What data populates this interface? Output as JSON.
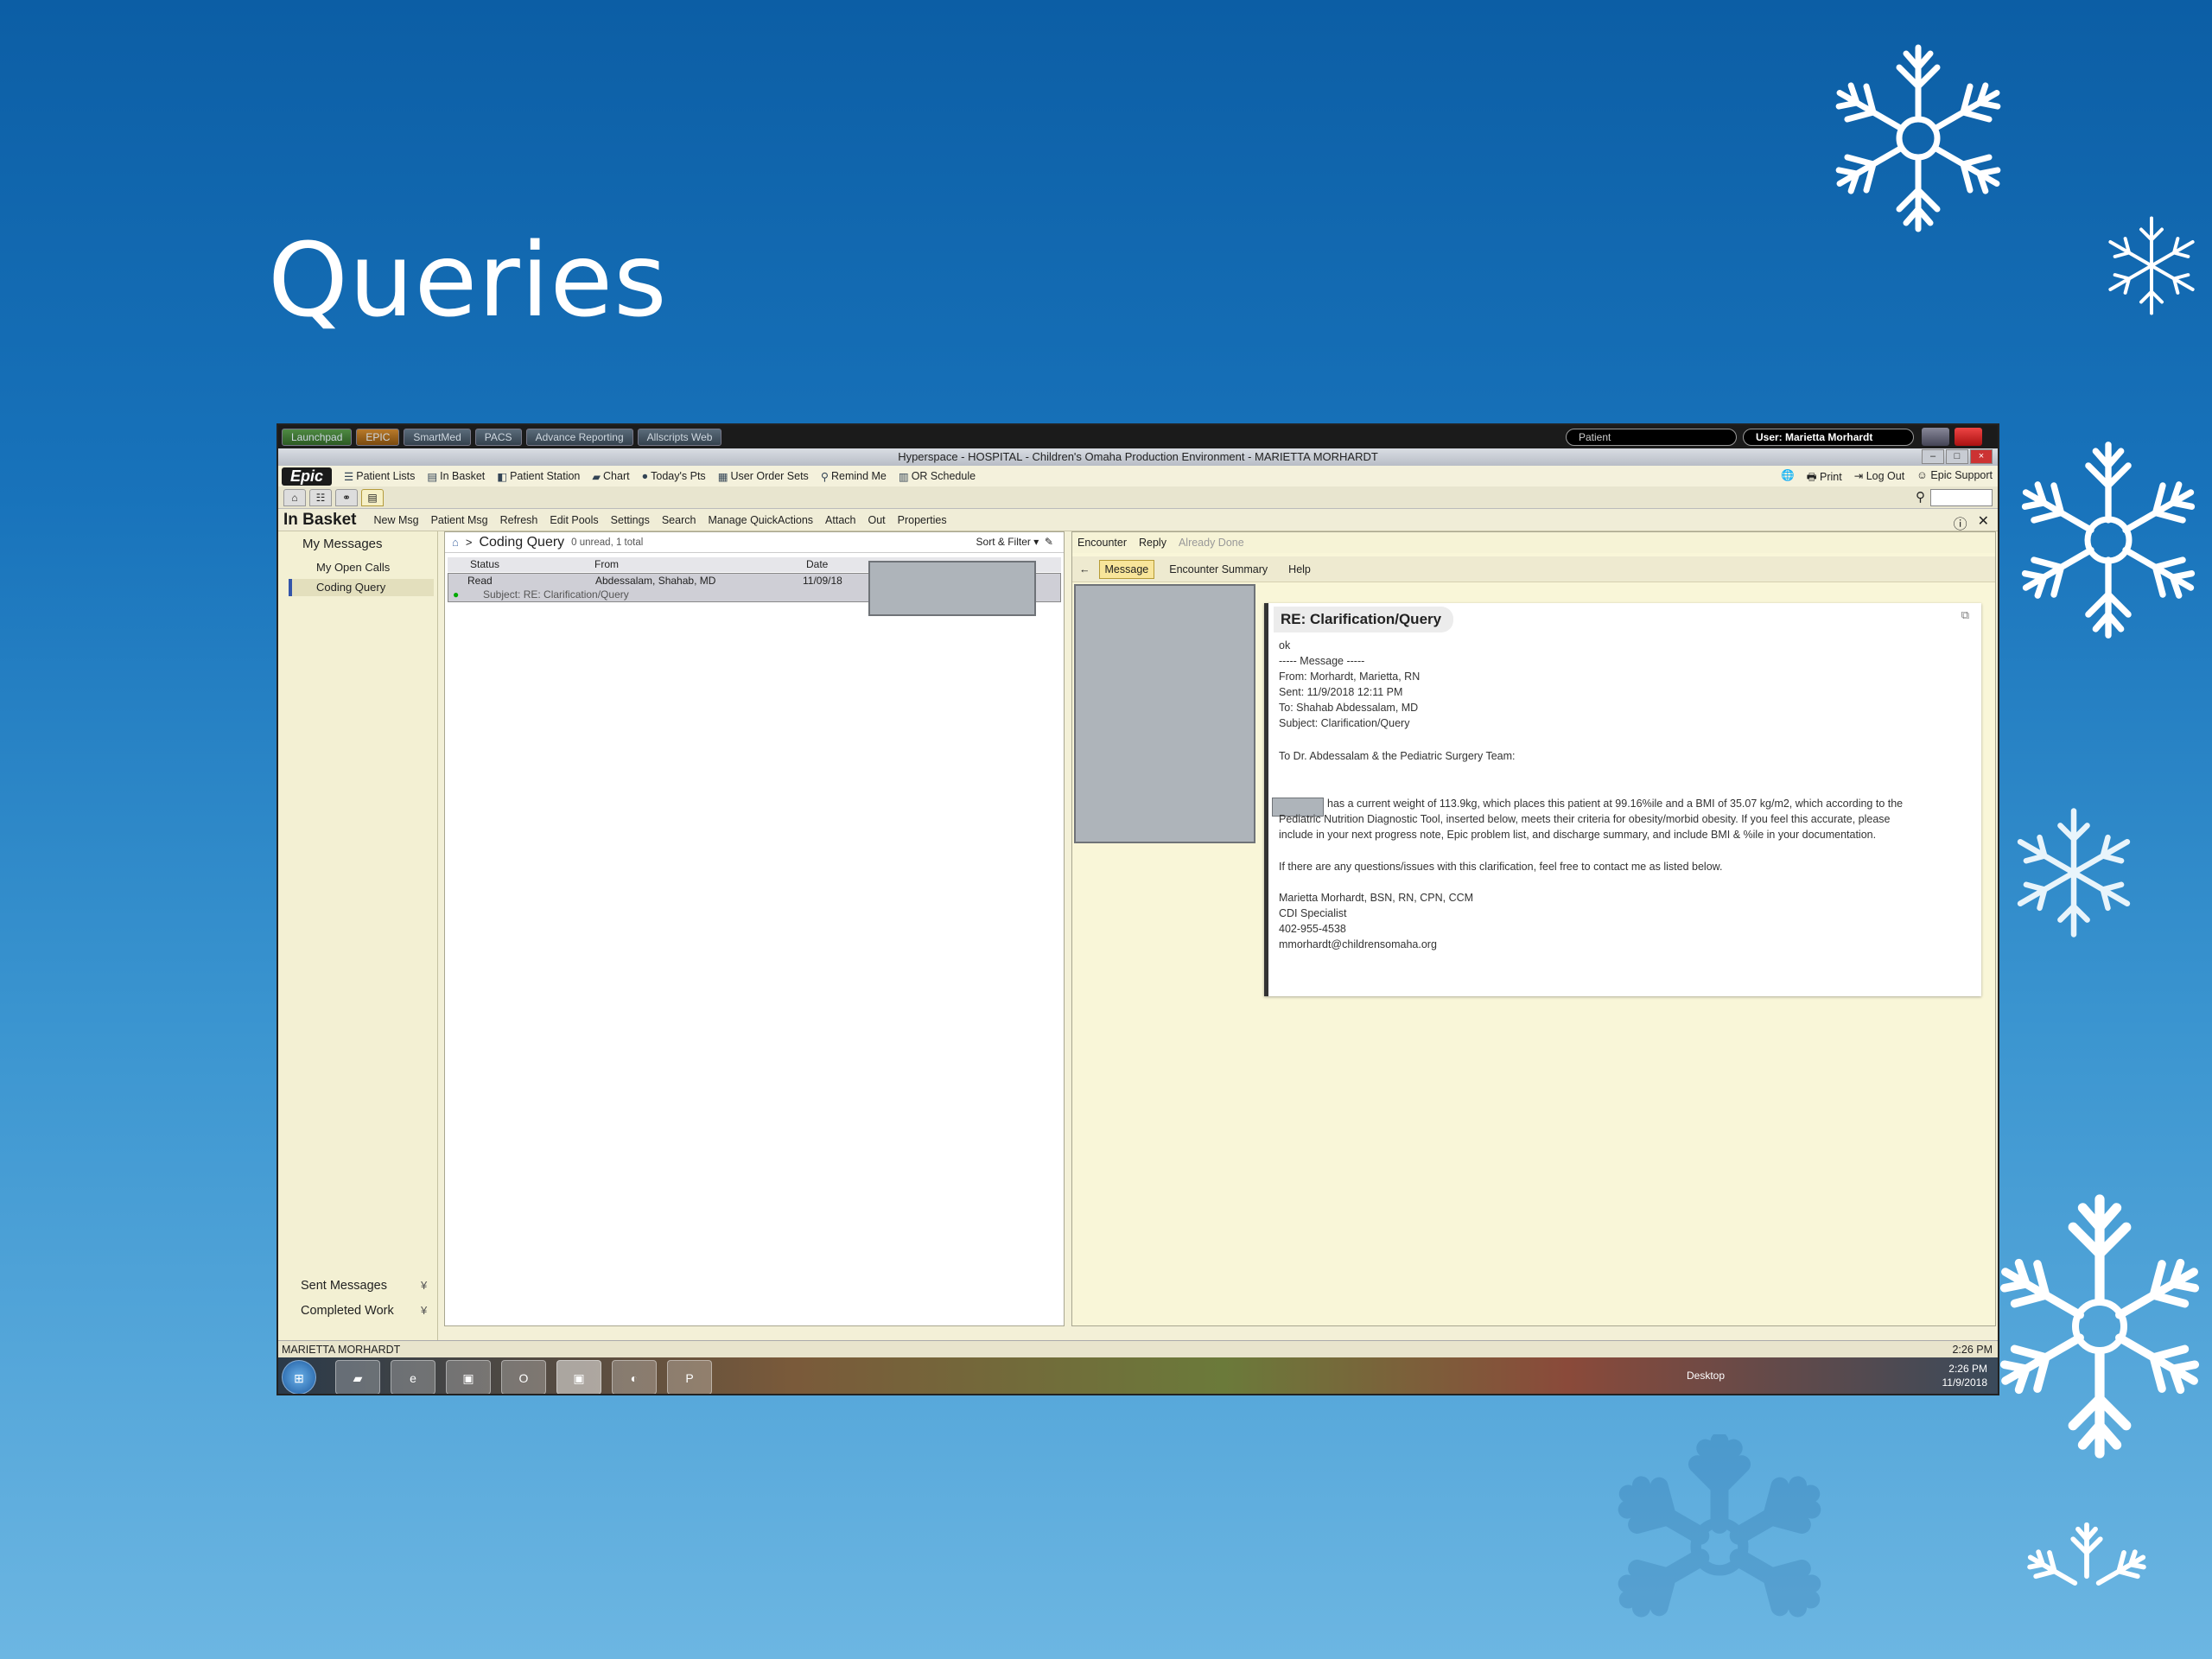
{
  "slide": {
    "title": "Queries"
  },
  "citrix": {
    "tabs": [
      "Launchpad",
      "EPIC",
      "SmartMed",
      "PACS",
      "Advance Reporting",
      "Allscripts Web"
    ],
    "patient_field": "Patient",
    "user_field": "User: Marietta Morhardt"
  },
  "window": {
    "title": "Hyperspace - HOSPITAL - Children's Omaha Production Environment - MARIETTA MORHARDT"
  },
  "toolbar": {
    "logo": "Epic",
    "items": [
      "Patient Lists",
      "In Basket",
      "Patient Station",
      "Chart",
      "Today's Pts",
      "User Order Sets",
      "Remind Me",
      "OR Schedule"
    ],
    "right_items": [
      "Print",
      "Log Out",
      "Epic Support"
    ]
  },
  "inbasket": {
    "title": "In Basket",
    "actions": [
      "New Msg",
      "Patient Msg",
      "Refresh",
      "Edit Pools",
      "Settings",
      "Search",
      "Manage QuickActions",
      "Attach",
      "Out",
      "Properties"
    ]
  },
  "leftnav": {
    "header": "My Messages",
    "items": [
      "My Open Calls",
      "Coding Query"
    ],
    "bottom": [
      "Sent Messages",
      "Completed Work"
    ]
  },
  "list": {
    "folder": "Coding Query",
    "count": "0 unread, 1 total",
    "sort": "Sort & Filter",
    "columns": {
      "status": "Status",
      "from": "From",
      "date": "Date"
    },
    "row": {
      "status": "Read",
      "from": "Abdessalam, Shahab, MD",
      "date": "11/09/18",
      "subject": "Subject: RE: Clarification/Query"
    }
  },
  "reader": {
    "actions": [
      "Encounter",
      "Reply",
      "Already Done"
    ],
    "tabs": [
      "Message",
      "Encounter Summary",
      "Help"
    ],
    "subject": "RE: Clarification/Query",
    "lines": [
      "ok",
      "----- Message -----",
      "From: Morhardt, Marietta, RN",
      "Sent: 11/9/2018  12:11 PM",
      "To: Shahab Abdessalam, MD",
      "Subject: Clarification/Query",
      "",
      "To Dr. Abdessalam & the Pediatric Surgery Team:",
      "",
      "",
      "has a current weight of 113.9kg, which places this patient at 99.16%ile and a BMI of 35.07 kg/m2, which according to the",
      "Pediatric Nutrition Diagnostic Tool, inserted below, meets their criteria for obesity/morbid obesity.  If you feel this accurate, please",
      "include in your next progress note, Epic problem list, and discharge summary, and include BMI & %ile in your documentation.",
      "",
      "If there are any questions/issues with this clarification, feel free to contact me as listed below.",
      "",
      "Marietta Morhardt, BSN, RN, CPN, CCM",
      "CDI Specialist",
      "402-955-4538",
      "mmorhardt@childrensomaha.org"
    ]
  },
  "statusbar": {
    "user": "MARIETTA MORHARDT",
    "time": "2:26 PM"
  },
  "taskbar": {
    "desktop": "Desktop",
    "time": "2:26 PM",
    "date": "11/9/2018"
  }
}
